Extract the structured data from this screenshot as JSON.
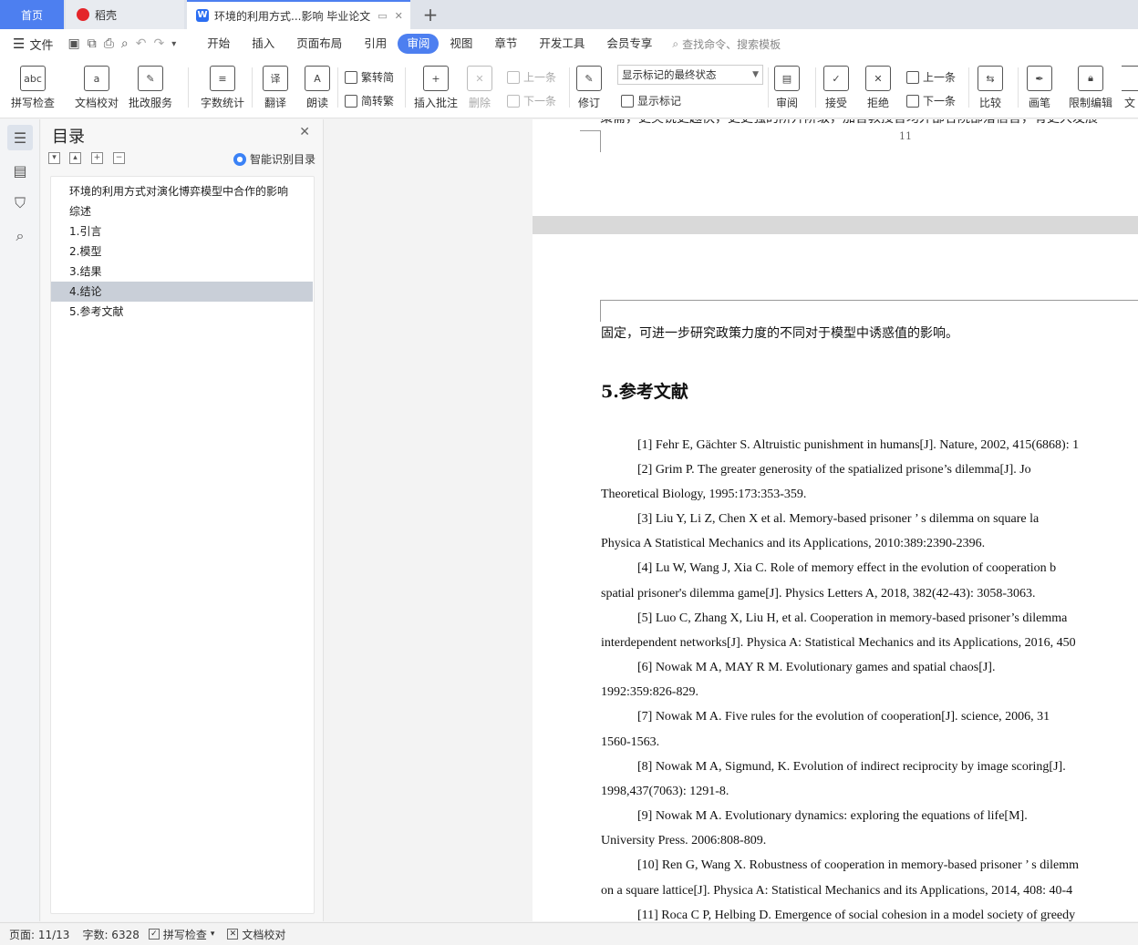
{
  "tabs": {
    "home": "首页",
    "daoke": "稻壳",
    "doc": "环境的利用方式...影响 毕业论文",
    "add": "+"
  },
  "menu": {
    "file": "文件",
    "items": [
      "开始",
      "插入",
      "页面布局",
      "引用",
      "审阅",
      "视图",
      "章节",
      "开发工具",
      "会员专享"
    ],
    "active": "审阅",
    "search": "查找命令、搜索模板"
  },
  "ribbon": {
    "spellcheck": "拼写检查",
    "doccheck": "文档校对",
    "review_service": "批改服务",
    "wordcount": "字数统计",
    "translate": "翻译",
    "read": "朗读",
    "trad2simp": "繁转简",
    "simp2trad": "简转繁",
    "insert_comment": "插入批注",
    "delete": "删除",
    "prev_comment": "上一条",
    "next_comment": "下一条",
    "track": "修订",
    "markup_state": "显示标记的最终状态",
    "show_markup": "显示标记",
    "review": "审阅",
    "accept": "接受",
    "reject": "拒绝",
    "prev_change": "上一条",
    "next_change": "下一条",
    "compare": "比较",
    "ink": "画笔",
    "restrict": "限制编辑",
    "doc_cut": "文"
  },
  "toc": {
    "title": "目录",
    "smart": "智能识别目录",
    "items": [
      "环境的利用方式对演化博弈模型中合作的影响",
      "综述",
      "1.引言",
      "2.模型",
      "3.结果",
      "4.结论",
      "5.参考文献"
    ],
    "selected_index": 5
  },
  "document": {
    "page_number": "11",
    "prev_page_fragment": "策需，更尖锐更越快，更更强的阶升阶级，加言教授言均外部各院部落信言，有更大发展",
    "intro_line": "固定，可进一步研究政策力度的不同对于模型中诱惑值的影响。",
    "ref_heading": "5.参考文献",
    "lines": [
      "[1] Fehr E, Gächter S. Altruistic punishment in humans[J]. Nature, 2002, 415(6868): 1",
      "[2]  Grim  P.  The  greater  generosity  of  the  spatialized  prisone’s  dilemma[J].  Jo",
      "Theoretical Biology, 1995:173:353-359.",
      "[3] Liu Y, Li Z, Chen X et al. Memory-based prisoner ’ s dilemma on square la",
      "Physica A Statistical Mechanics and its Applications, 2010:389:2390-2396.",
      "[4] Lu W, Wang J, Xia C. Role of memory effect in the evolution of cooperation b",
      "spatial prisoner's dilemma game[J]. Physics Letters A, 2018, 382(42-43): 3058-3063.",
      "[5] Luo C, Zhang X, Liu H, et al. Cooperation in memory-based prisoner’s dilemma",
      "interdependent networks[J]. Physica A: Statistical Mechanics and its Applications, 2016, 450",
      "[6]  Nowak  M  A,  MAY  R  M.  Evolutionary  games  and  spatial  chaos[J].",
      "1992:359:826-829.",
      "[7] Nowak M A. Five rules for the evolution of cooperation[J]. science, 2006, 31",
      "1560-1563.",
      "[8] Nowak M A, Sigmund, K. Evolution of indirect reciprocity by image scoring[J].",
      "1998,437(7063): 1291-8.",
      "[9]  Nowak  M  A.  Evolutionary  dynamics:  exploring  the  equations  of  life[M].",
      "University Press. 2006:808-809.",
      "[10] Ren G, Wang X. Robustness of cooperation in memory-based prisoner ’ s dilemm",
      "on a square lattice[J]. Physica A: Statistical Mechanics and its Applications, 2014, 408: 40-4",
      "[11] Roca C P, Helbing D. Emergence of social cohesion in a model society of greedy"
    ]
  },
  "status": {
    "page": "页面: 11/13",
    "words": "字数: 6328",
    "spellcheck": "拼写检查",
    "doccheck": "文档校对"
  },
  "colors": {
    "accent": "#4d7ff0",
    "toc_selected": "#c9cfd8"
  }
}
